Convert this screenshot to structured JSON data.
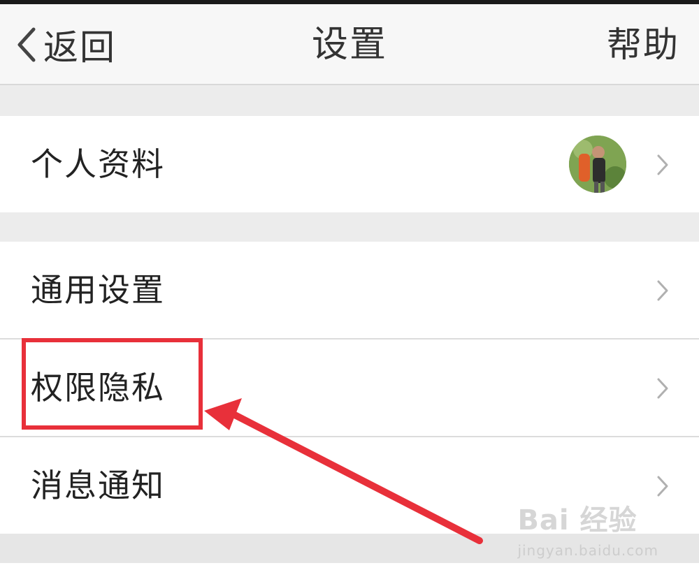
{
  "navbar": {
    "back_label": "返回",
    "title": "设置",
    "help_label": "帮助"
  },
  "sections": [
    {
      "items": [
        {
          "label": "个人资料",
          "has_avatar": true
        }
      ]
    },
    {
      "items": [
        {
          "label": "通用设置"
        },
        {
          "label": "权限隐私",
          "highlighted": true
        },
        {
          "label": "消息通知"
        }
      ]
    }
  ],
  "colors": {
    "highlight": "#e8303a",
    "background": "#ececec",
    "navbar": "#f7f7f7"
  },
  "icons": {
    "back": "chevron-left-icon",
    "row": "chevron-right-icon"
  },
  "watermark": {
    "brand": "Bai 经验",
    "url": "jingyan.baidu.com"
  }
}
